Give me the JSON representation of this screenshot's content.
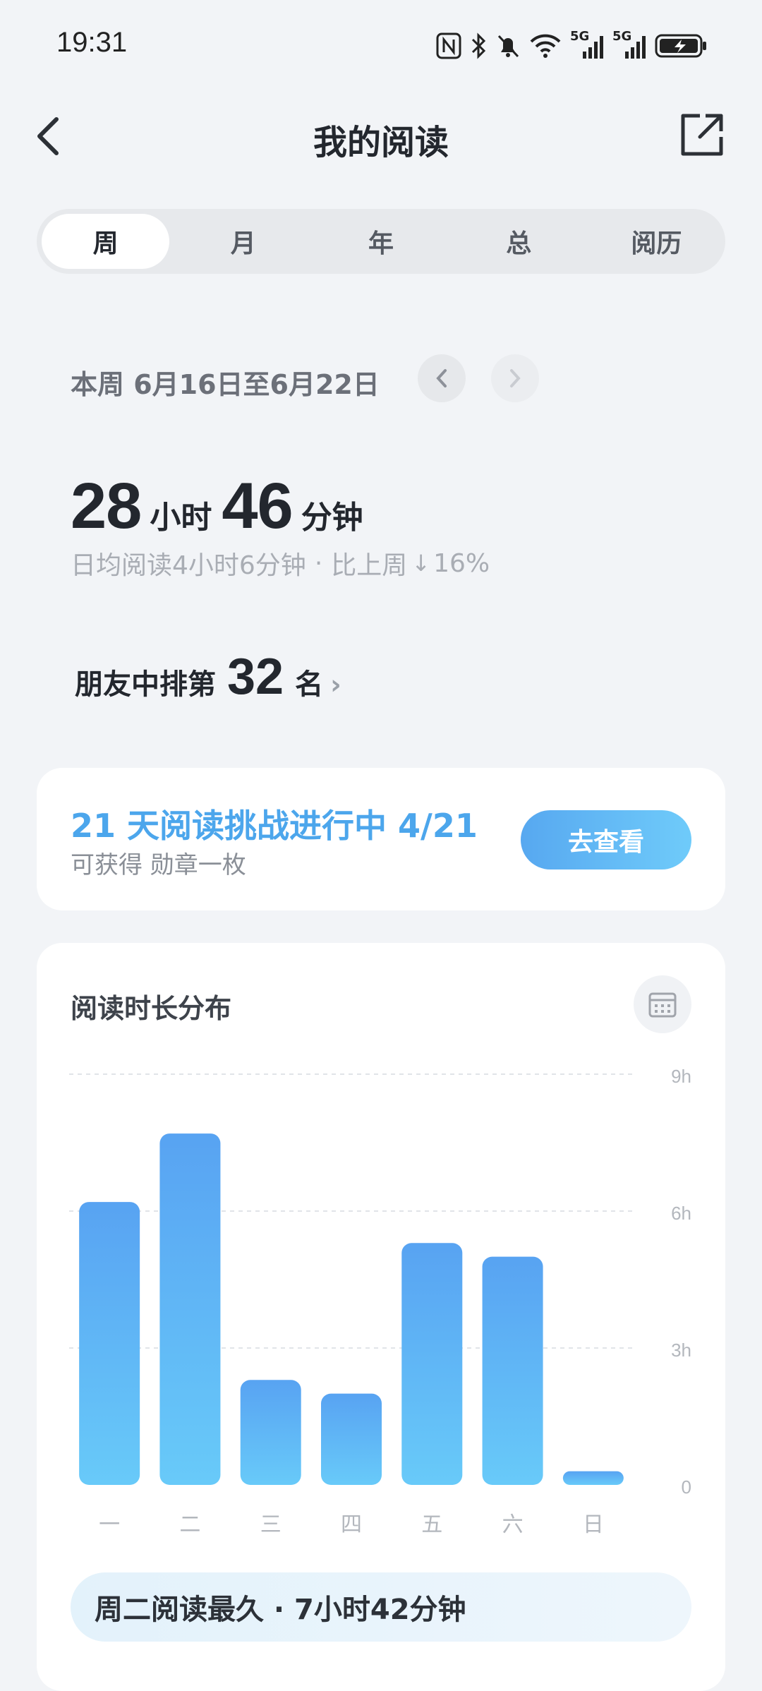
{
  "status_bar": {
    "time": "19:31",
    "icons": [
      "nfc-icon",
      "bluetooth-icon",
      "mute-icon",
      "wifi-icon",
      "signal-5g-icon",
      "signal-5g-icon",
      "battery-charging-icon"
    ],
    "signal_label": "5G"
  },
  "header": {
    "title": "我的阅读",
    "back_icon": "back-icon",
    "share_icon": "share-icon"
  },
  "tabs": [
    {
      "label": "周",
      "active": true
    },
    {
      "label": "月",
      "active": false
    },
    {
      "label": "年",
      "active": false
    },
    {
      "label": "总",
      "active": false
    },
    {
      "label": "阅历",
      "active": false
    }
  ],
  "week": {
    "range": "本周 6月16日至6月22日"
  },
  "total": {
    "hours": "28",
    "hours_unit": "小时",
    "minutes": "46",
    "minutes_unit": "分钟",
    "daily_avg": "日均阅读4小时6分钟",
    "separator": "·",
    "compare_label": "比上周",
    "compare_arrow": "↓",
    "compare_value": "16%"
  },
  "rank": {
    "prefix": "朋友中排第",
    "number": "32",
    "suffix": "名"
  },
  "challenge": {
    "title": "21 天阅读挑战进行中 4/21",
    "subtitle": "可获得 勋章一枚",
    "button": "去查看"
  },
  "chart_card": {
    "title": "阅读时长分布",
    "calendar_icon": "calendar-icon"
  },
  "chart_data": {
    "type": "bar",
    "categories": [
      "一",
      "二",
      "三",
      "四",
      "五",
      "六",
      "日"
    ],
    "values": [
      6.2,
      7.7,
      2.3,
      2.0,
      5.3,
      5.0,
      0.3
    ],
    "ylim": [
      0,
      9
    ],
    "yticks": [
      0,
      3,
      6,
      9
    ],
    "ytick_labels": [
      "0",
      "3h",
      "6h",
      "9h"
    ],
    "bar_gradient": [
      "#58A3F2",
      "#68CAF9"
    ],
    "grid": true
  },
  "summary": {
    "text": "周二阅读最久 · 7小时42分钟"
  }
}
